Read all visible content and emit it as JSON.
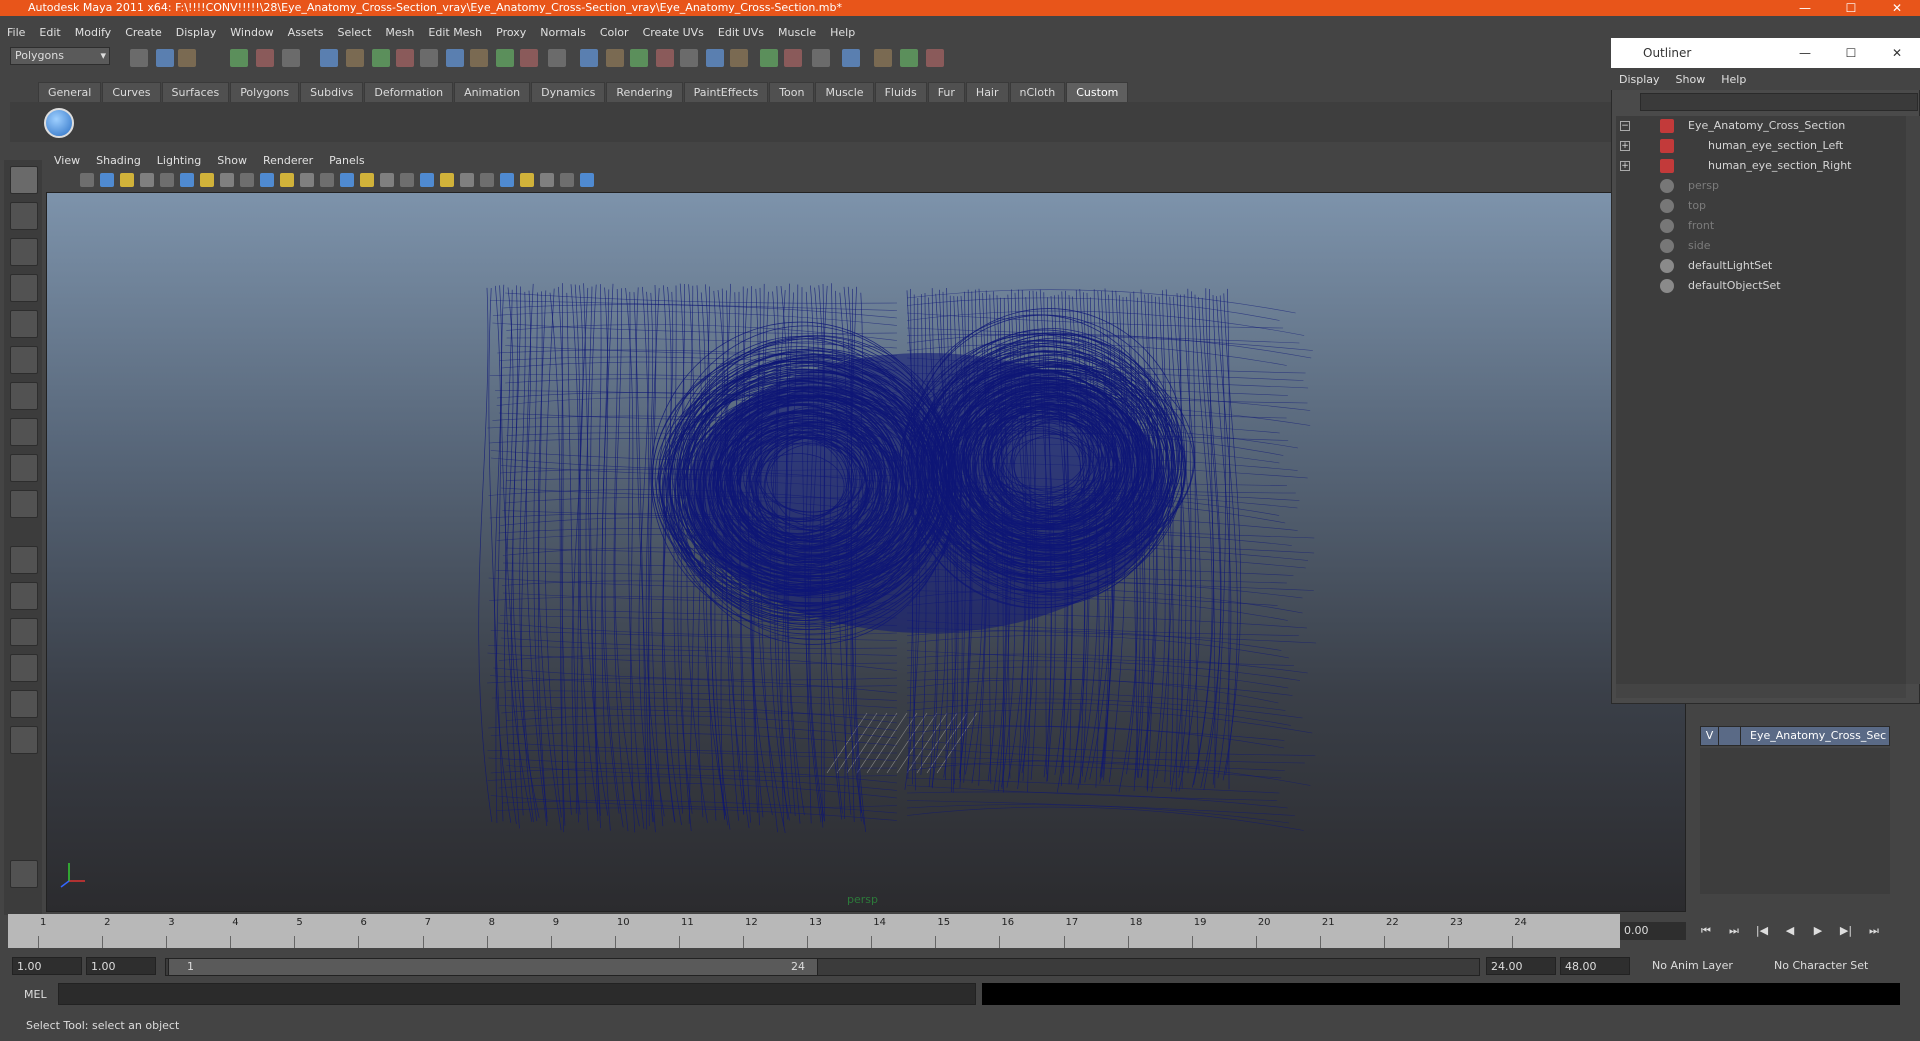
{
  "window": {
    "title": "Autodesk Maya 2011 x64: F:\\!!!!CONV!!!!!\\28\\Eye_Anatomy_Cross-Section_vray\\Eye_Anatomy_Cross-Section_vray\\Eye_Anatomy_Cross-Section.mb*",
    "minimize": "—",
    "maximize": "☐",
    "close": "✕"
  },
  "menubar": [
    "File",
    "Edit",
    "Modify",
    "Create",
    "Display",
    "Window",
    "Assets",
    "Select",
    "Mesh",
    "Edit Mesh",
    "Proxy",
    "Normals",
    "Color",
    "Create UVs",
    "Edit UVs",
    "Muscle",
    "Help"
  ],
  "mode_select": "Polygons",
  "shelf": {
    "tabs": [
      "General",
      "Curves",
      "Surfaces",
      "Polygons",
      "Subdivs",
      "Deformation",
      "Animation",
      "Dynamics",
      "Rendering",
      "PaintEffects",
      "Toon",
      "Muscle",
      "Fluids",
      "Fur",
      "Hair",
      "nCloth",
      "Custom"
    ],
    "active": "Custom"
  },
  "viewport": {
    "menu": [
      "View",
      "Shading",
      "Lighting",
      "Show",
      "Renderer",
      "Panels"
    ],
    "camera": "persp",
    "wire_color": "#0e1676"
  },
  "timeline": {
    "ticks": [
      "1",
      "2",
      "3",
      "4",
      "5",
      "6",
      "7",
      "8",
      "9",
      "10",
      "11",
      "12",
      "13",
      "14",
      "15",
      "16",
      "17",
      "18",
      "19",
      "20",
      "21",
      "22",
      "23",
      "24"
    ],
    "current_frame": "0.00"
  },
  "playback": [
    "⏮",
    "⏭",
    "|◀",
    "◀",
    "▶",
    "▶|",
    "⏭"
  ],
  "range": {
    "start": "1.00",
    "start2": "1.00",
    "slider_start": "1",
    "slider_end": "24",
    "end": "24.00",
    "end2": "48.00",
    "anim_layer": "No Anim Layer",
    "char_set": "No Character Set"
  },
  "cmdline": {
    "label": "MEL"
  },
  "helpline": "Select Tool: select an object",
  "outliner": {
    "title": "Outliner",
    "menu": [
      "Display",
      "Show",
      "Help"
    ],
    "items": [
      {
        "label": "Eye_Anatomy_Cross_Section",
        "kind": "group"
      },
      {
        "label": "human_eye_section_Left",
        "kind": "mesh"
      },
      {
        "label": "human_eye_section_Right",
        "kind": "mesh"
      },
      {
        "label": "persp",
        "kind": "camera"
      },
      {
        "label": "top",
        "kind": "camera"
      },
      {
        "label": "front",
        "kind": "camera"
      },
      {
        "label": "side",
        "kind": "camera"
      },
      {
        "label": "defaultLightSet",
        "kind": "set"
      },
      {
        "label": "defaultObjectSet",
        "kind": "set"
      }
    ]
  },
  "layer": {
    "visible": "V",
    "name": "Eye_Anatomy_Cross_Sec"
  }
}
